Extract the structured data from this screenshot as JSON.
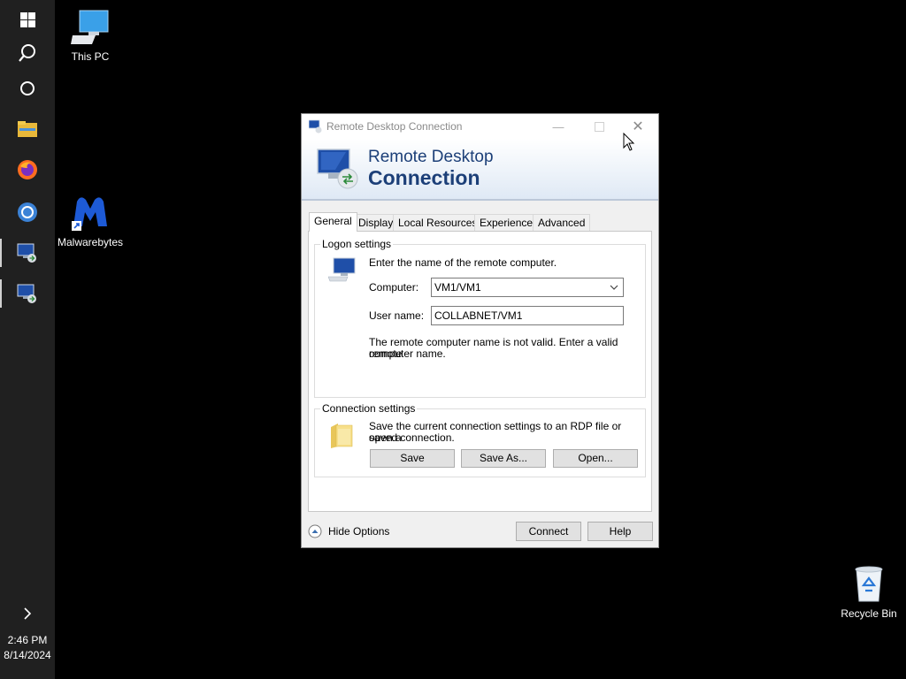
{
  "desktop": {
    "icons": [
      {
        "label": "This PC",
        "icon": "this-pc-icon"
      },
      {
        "label": "Malwarebytes",
        "icon": "malwarebytes-icon"
      },
      {
        "label": "Recycle Bin",
        "icon": "recycle-bin-icon"
      }
    ]
  },
  "taskbar": {
    "items": [
      "start-icon",
      "search-icon",
      "cortana-icon",
      "file-explorer-icon",
      "firefox-icon",
      "chrome-icon",
      "remote-desktop-icon",
      "remote-desktop-icon"
    ],
    "clock": {
      "time": "2:46 PM",
      "date": "8/14/2024"
    }
  },
  "dialog": {
    "title": "Remote Desktop Connection",
    "banner": {
      "line1": "Remote Desktop",
      "line2": "Connection"
    },
    "tabs": [
      "General",
      "Display",
      "Local Resources",
      "Experience",
      "Advanced"
    ],
    "selected_tab": "General",
    "logon": {
      "group_label": "Logon settings",
      "instruction": "Enter the name of the remote computer.",
      "computer_label": "Computer:",
      "computer_value": "VM1/VM1",
      "username_label": "User name:",
      "username_value": "COLLABNET/VM1",
      "error_line1": "The remote computer name is not valid. Enter a valid remote",
      "error_line2": "computer name."
    },
    "connection": {
      "group_label": "Connection settings",
      "desc_line1": "Save the current connection settings to an RDP file or open a",
      "desc_line2": "saved connection.",
      "save": "Save",
      "save_as": "Save As...",
      "open": "Open..."
    },
    "footer": {
      "hide_options": "Hide Options",
      "connect": "Connect",
      "help": "Help"
    }
  },
  "colors": {
    "taskbar": "#202020",
    "banner_text": "#1c3f78",
    "desktop": "#000000"
  }
}
